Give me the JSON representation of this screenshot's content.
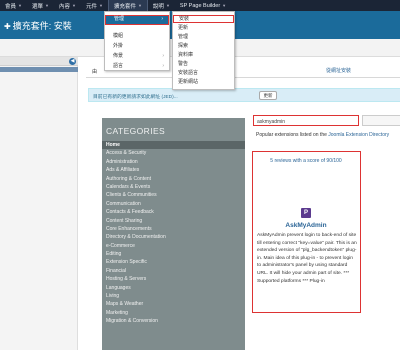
{
  "topnav": {
    "items": [
      "會員",
      "選單",
      "內容",
      "元件",
      "擴充套件",
      "說明",
      "SP Page Builder"
    ]
  },
  "header": {
    "title": "擴充套件: 安裝"
  },
  "tabs": {
    "first": "由",
    "second": "從網址安裝"
  },
  "infobar": {
    "text": "目前已有新的更新請求如此網址 (JED)...",
    "button": "更新"
  },
  "extensions_menu": {
    "items": [
      "管理",
      "模組",
      "外掛",
      "佈景",
      "語言"
    ]
  },
  "manage_submenu": {
    "items": [
      "安裝",
      "更新",
      "管理",
      "探索",
      "資料庫",
      "警告",
      "安裝語言",
      "更新網站"
    ]
  },
  "categories": {
    "title": "CATEGORIES",
    "items": [
      "Home",
      "Access & Security",
      "Administration",
      "Ads & Affiliates",
      "Authoring & Content",
      "Calendars & Events",
      "Clients & Communities",
      "Communication",
      "Contacts & Feedback",
      "Content Sharing",
      "Core Enhancements",
      "Directory & Documentation",
      "e-Commerce",
      "Editing",
      "Extension Specific",
      "Financial",
      "Hosting & Servers",
      "Languages",
      "Living",
      "Maps & Weather",
      "Marketing",
      "Migration & Conversion"
    ]
  },
  "search": {
    "value": "askmyadmin"
  },
  "popular": {
    "prefix": "Popular extensions listed on the ",
    "link": "Joomla Extension Directory"
  },
  "extension": {
    "reviews": "5 reviews with a score of 90/100",
    "icon_letter": "P",
    "name": "AskMyAdmin",
    "description": "AskMyAdmin prevent login to back-end of site till entering correct \"key=value\" pair. This is an extended version of \"plg_backendtoken\" plug-in. Main idea of this plug-in - to prevent login to administrator's panel by using standard URL. It will hide your admin part of site. *** Supported platforms *** Plug-in"
  },
  "colors": {
    "nav": "#1b2536",
    "header": "#1b6b9b",
    "highlight": "#dd3333",
    "category_panel": "#7f8c8d"
  }
}
